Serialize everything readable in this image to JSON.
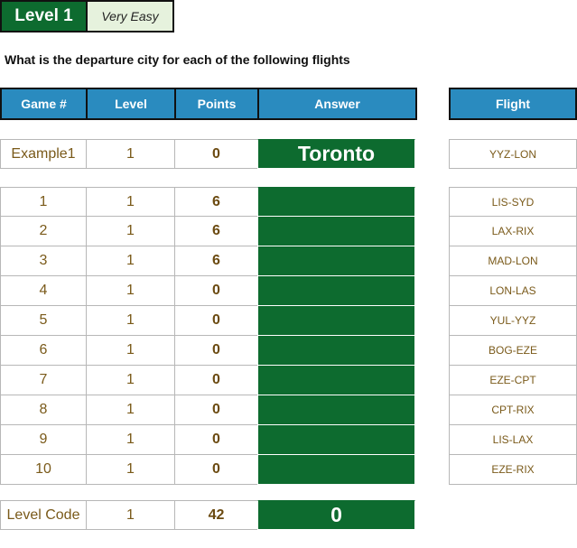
{
  "header": {
    "level_label": "Level 1",
    "difficulty": "Very Easy"
  },
  "question": "What is the departure city for each of the following flights",
  "columns": {
    "game": "Game #",
    "level": "Level",
    "points": "Points",
    "answer": "Answer",
    "flight": "Flight"
  },
  "example": {
    "game": "Example1",
    "level": "1",
    "points": "0",
    "answer": "Toronto",
    "flight": "YYZ-LON"
  },
  "rows": [
    {
      "game": "1",
      "level": "1",
      "points": "6",
      "answer": "",
      "flight": "LIS-SYD"
    },
    {
      "game": "2",
      "level": "1",
      "points": "6",
      "answer": "",
      "flight": "LAX-RIX"
    },
    {
      "game": "3",
      "level": "1",
      "points": "6",
      "answer": "",
      "flight": "MAD-LON"
    },
    {
      "game": "4",
      "level": "1",
      "points": "0",
      "answer": "",
      "flight": "LON-LAS"
    },
    {
      "game": "5",
      "level": "1",
      "points": "0",
      "answer": "",
      "flight": "YUL-YYZ"
    },
    {
      "game": "6",
      "level": "1",
      "points": "0",
      "answer": "",
      "flight": "BOG-EZE"
    },
    {
      "game": "7",
      "level": "1",
      "points": "0",
      "answer": "",
      "flight": "EZE-CPT"
    },
    {
      "game": "8",
      "level": "1",
      "points": "0",
      "answer": "",
      "flight": "CPT-RIX"
    },
    {
      "game": "9",
      "level": "1",
      "points": "0",
      "answer": "",
      "flight": "LIS-LAX"
    },
    {
      "game": "10",
      "level": "1",
      "points": "0",
      "answer": "",
      "flight": "EZE-RIX"
    }
  ],
  "footer": {
    "label": "Level Code",
    "level": "1",
    "points": "42",
    "code": "0"
  },
  "colors": {
    "header_blue": "#2a8bbf",
    "answer_green": "#0d6b2f",
    "difficulty_bg": "#e6f2dd",
    "value_brown": "#7a5a1a"
  }
}
